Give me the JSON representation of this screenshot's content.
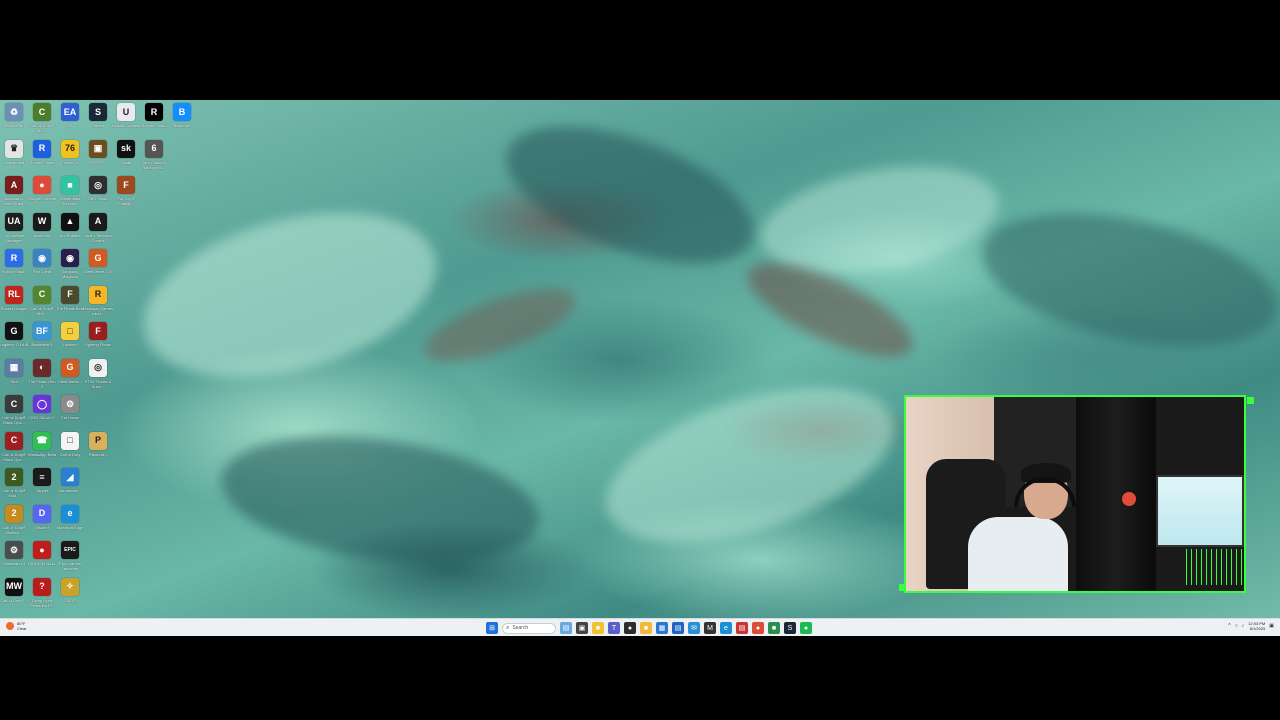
{
  "desktop": {
    "icons": [
      {
        "label": "Recycle Bin",
        "glyph": "♻",
        "color": "#6d8fb5"
      },
      {
        "label": "Call of Duty® MW...",
        "glyph": "C",
        "color": "#4d7d2a"
      },
      {
        "label": "EA",
        "glyph": "EA",
        "color": "#2f5fd0"
      },
      {
        "label": "Steam",
        "glyph": "S",
        "color": "#1b2838"
      },
      {
        "label": "Ubisoft Connect",
        "glyph": "U",
        "color": "#e9e9f0"
      },
      {
        "label": "Roblox Studio",
        "glyph": "R",
        "color": "#000000"
      },
      {
        "label": "Battle.net",
        "glyph": "B",
        "color": "#148eff"
      },
      {
        "label": "Undisputed",
        "glyph": "♛",
        "color": "#e4e4e4"
      },
      {
        "label": "Roblox Player",
        "glyph": "R",
        "color": "#1d5fe0"
      },
      {
        "label": "Fallout 76",
        "glyph": "76",
        "color": "#f2c21c"
      },
      {
        "label": "R.E.P.O.",
        "glyph": "▣",
        "color": "#6b4e1e"
      },
      {
        "label": "Skate",
        "glyph": "sk",
        "color": "#111111"
      },
      {
        "label": "Tom Clancy's Rainbow Si...",
        "glyph": "6",
        "color": "#555555"
      },
      {
        "label": "Assassin's Creed Shad...",
        "glyph": "A",
        "color": "#7a1d1d"
      },
      {
        "label": "Google Chrome",
        "glyph": "●",
        "color": "#de4b39"
      },
      {
        "label": "Streamlabs Desktop",
        "glyph": "■",
        "color": "#31c3a2"
      },
      {
        "label": "OBS Studio",
        "glyph": "◎",
        "color": "#302e31"
      },
      {
        "label": "Far Cry 5 Fatality...",
        "glyph": "F",
        "color": "#9b4a20"
      },
      {
        "label": "UA License Manager",
        "glyph": "UA",
        "color": "#1e1e1e"
      },
      {
        "label": "Wave Link",
        "glyph": "W",
        "color": "#1a1a1a"
      },
      {
        "label": "Arc Raiders",
        "glyph": "▲",
        "color": "#101010"
      },
      {
        "label": "Audio-Technica Control",
        "glyph": "A",
        "color": "#1a1a1a"
      },
      {
        "label": "Roblox Studio",
        "glyph": "R",
        "color": "#2e6be6"
      },
      {
        "label": "Riot Client",
        "glyph": "◉",
        "color": "#3b83c7"
      },
      {
        "label": "Samsung Magician",
        "glyph": "◉",
        "color": "#2a1f4c"
      },
      {
        "label": "SteelSeries GG",
        "glyph": "G",
        "color": "#d25a20"
      },
      {
        "label": "Rocket League",
        "glyph": "RL",
        "color": "#c1261d"
      },
      {
        "label": "Call of Duty® MW...",
        "glyph": "C",
        "color": "#53862f"
      },
      {
        "label": "The Finals Beta",
        "glyph": "F",
        "color": "#4b4a2e"
      },
      {
        "label": "Rockstar Games Laun...",
        "glyph": "R",
        "color": "#f7b625"
      },
      {
        "label": "Logitech G HUB",
        "glyph": "G",
        "color": "#111111"
      },
      {
        "label": "Battlefield 6",
        "glyph": "BF",
        "color": "#3a95d6"
      },
      {
        "label": "Untitled",
        "glyph": "□",
        "color": "#f5cf3c"
      },
      {
        "label": "Fighting Flicker",
        "glyph": "F",
        "color": "#9a1e1e"
      },
      {
        "label": "Sea",
        "glyph": "▦",
        "color": "#5c7ca6"
      },
      {
        "label": "The Finals Gen 2",
        "glyph": "◐",
        "color": "#6b2a2a"
      },
      {
        "label": "SteelSeries...",
        "glyph": "G",
        "color": "#d25a20"
      },
      {
        "label": "ETS2 Trucks & Such...",
        "glyph": "◎",
        "color": "#f0f0f0"
      },
      {
        "label": "Call of Duty® Black Ops...",
        "glyph": "C",
        "color": "#3a3a3a"
      },
      {
        "label": "ODD SALAXY",
        "glyph": "◯",
        "color": "#6a35d6"
      },
      {
        "label": "Fat Horse",
        "glyph": "⚙",
        "color": "#8a8a8a"
      },
      {
        "label": "Call of Duty® Black Ops...",
        "glyph": "C",
        "color": "#9d1f1f"
      },
      {
        "label": "WhatsApp Beta",
        "glyph": "☎",
        "color": "#2fbf52"
      },
      {
        "label": "Call of Duty",
        "glyph": "□",
        "color": "#f4f4f4"
      },
      {
        "label": "Palworld...",
        "glyph": "P",
        "color": "#d8b15a"
      },
      {
        "label": "Call of Duty® Mod...",
        "glyph": "2",
        "color": "#3e5a20"
      },
      {
        "label": "Clipper",
        "glyph": "≡",
        "color": "#1b1b1b"
      },
      {
        "label": "Kamakoshi...",
        "glyph": "◢",
        "color": "#2a7fd0"
      },
      {
        "label": "Call of Duty® Modern...",
        "glyph": "2",
        "color": "#c88a1a"
      },
      {
        "label": "Discord",
        "glyph": "D",
        "color": "#5865f2"
      },
      {
        "label": "Microsoft Edge",
        "glyph": "e",
        "color": "#1b8fd6"
      },
      {
        "label": "Wasteland 3",
        "glyph": "⚙",
        "color": "#4c4c4c"
      },
      {
        "label": "DRAGON BALL S...",
        "glyph": "●",
        "color": "#c21d1d"
      },
      {
        "label": "Epic Games Launcher",
        "glyph": "EPIC",
        "color": "#1a1a1a"
      },
      {
        "label": "Call of Duty®...",
        "glyph": "MW",
        "color": "#101010"
      },
      {
        "label": "Dying Light Reloaded E...",
        "glyph": "?",
        "color": "#b81c1c"
      },
      {
        "label": "CS:GO",
        "glyph": "✧",
        "color": "#c9a227"
      }
    ]
  },
  "webcam": {
    "label": "webcam feed"
  },
  "taskbar": {
    "weather": {
      "temp": "80°F",
      "condition": "Clear"
    },
    "search_placeholder": "Search",
    "pinned": [
      {
        "name": "start",
        "glyph": "⊞",
        "color": "#1e73d6"
      },
      {
        "name": "widgets",
        "glyph": "▤",
        "color": "#6aa9e0"
      },
      {
        "name": "task-view",
        "glyph": "▣",
        "color": "#444444"
      },
      {
        "name": "file-explorer",
        "glyph": "■",
        "color": "#f1c232"
      },
      {
        "name": "teams",
        "glyph": "T",
        "color": "#5b5fc7"
      },
      {
        "name": "app",
        "glyph": "●",
        "color": "#2d2d2d"
      },
      {
        "name": "explorer",
        "glyph": "■",
        "color": "#f2b83b"
      },
      {
        "name": "store",
        "glyph": "▦",
        "color": "#2b78d4"
      },
      {
        "name": "calendar",
        "glyph": "▤",
        "color": "#1f64c2"
      },
      {
        "name": "mail",
        "glyph": "✉",
        "color": "#2a8fd8"
      },
      {
        "name": "media",
        "glyph": "M",
        "color": "#333333"
      },
      {
        "name": "edge",
        "glyph": "e",
        "color": "#1b8fd6"
      },
      {
        "name": "app-red",
        "glyph": "▤",
        "color": "#c93434"
      },
      {
        "name": "chrome",
        "glyph": "●",
        "color": "#de4b39"
      },
      {
        "name": "terminal",
        "glyph": "■",
        "color": "#2a8e4f"
      },
      {
        "name": "steam",
        "glyph": "S",
        "color": "#1b2838"
      },
      {
        "name": "spotify",
        "glyph": "●",
        "color": "#1db954"
      }
    ],
    "tray": {
      "chevron": "^",
      "clock_time": "12:03 PM",
      "clock_date": "8/1/2025"
    }
  }
}
